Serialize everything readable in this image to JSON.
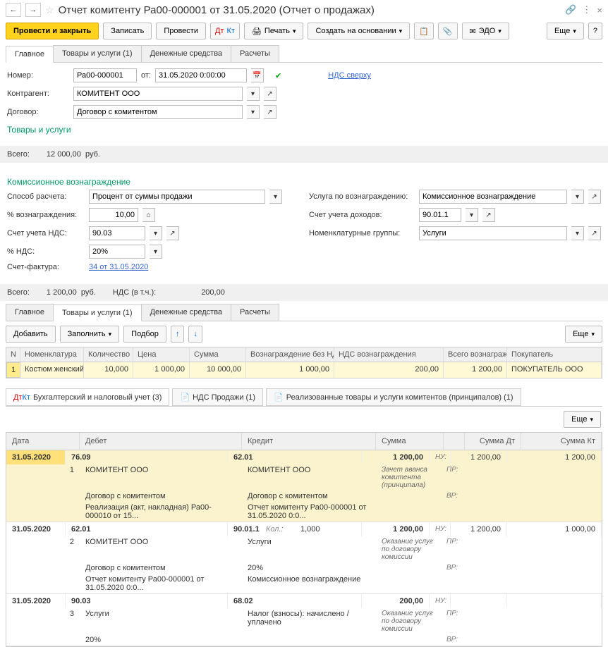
{
  "header": {
    "title": "Отчет комитенту Ра00-000001 от 31.05.2020 (Отчет о продажах)"
  },
  "toolbar": {
    "post_close": "Провести и закрыть",
    "write": "Записать",
    "post": "Провести",
    "print": "Печать",
    "create_based": "Создать на основании",
    "edo": "ЭДО",
    "more": "Еще"
  },
  "tabs": {
    "main": "Главное",
    "goods": "Товары и услуги (1)",
    "cash": "Денежные средства",
    "calc": "Расчеты"
  },
  "form": {
    "number_label": "Номер:",
    "number": "Ра00-000001",
    "from_label": "от:",
    "date": "31.05.2020 0:00:00",
    "vat_link": "НДС сверху",
    "counterparty_label": "Контрагент:",
    "counterparty": "КОМИТЕНТ ООО",
    "contract_label": "Договор:",
    "contract": "Договор с комитентом"
  },
  "goods_section": {
    "heading": "Товары и услуги",
    "total_label": "Всего:",
    "total": "12 000,00",
    "currency": "руб."
  },
  "commission": {
    "heading": "Комиссионное вознаграждение",
    "method_label": "Способ расчета:",
    "method": "Процент от суммы продажи",
    "service_label": "Услуга по вознаграждению:",
    "service": "Комиссионное вознаграждение",
    "percent_label": "% вознаграждения:",
    "percent": "10,00",
    "income_acc_label": "Счет учета доходов:",
    "income_acc": "90.01.1",
    "vat_acc_label": "Счет учета НДС:",
    "vat_acc": "90.03",
    "nom_group_label": "Номенклатурные группы:",
    "nom_group": "Услуги",
    "vat_rate_label": "% НДС:",
    "vat_rate": "20%",
    "invoice_label": "Счет-фактура:",
    "invoice_link": "34 от 31.05.2020",
    "totals": {
      "total_label": "Всего:",
      "total": "1 200,00",
      "currency": "руб.",
      "vat_label": "НДС (в т.ч.):",
      "vat": "200,00"
    }
  },
  "grid_toolbar": {
    "add": "Добавить",
    "fill": "Заполнить",
    "pick": "Подбор",
    "more": "Еще"
  },
  "grid": {
    "headers": {
      "n": "N",
      "nom": "Номенклатура",
      "qty": "Количество",
      "price": "Цена",
      "sum": "Сумма",
      "reward_novat": "Вознаграждение без НДС",
      "reward_vat": "НДС вознаграждения",
      "reward_total": "Всего вознаграждение",
      "buyer": "Покупатель"
    },
    "row": {
      "n": "1",
      "nom": "Костюм женский",
      "qty": "10,000",
      "price": "1 000,00",
      "sum": "10 000,00",
      "reward_novat": "1 000,00",
      "reward_vat": "200,00",
      "reward_total": "1 200,00",
      "buyer": "ПОКУПАТЕЛЬ ООО"
    }
  },
  "acc_tabs": {
    "accounting": "Бухгалтерский и налоговый учет (3)",
    "vat_sales": "НДС Продажи (1)",
    "realized": "Реализованные товары и услуги комитентов (принципалов) (1)",
    "more": "Еще"
  },
  "ledger": {
    "headers": {
      "date": "Дата",
      "debit": "Дебет",
      "credit": "Кредит",
      "sum": "Сумма",
      "sum_dt": "Сумма Дт",
      "sum_kt": "Сумма Кт"
    },
    "tags": {
      "nu": "НУ:",
      "pr": "ПР:",
      "vr": "ВР:",
      "kol": "Кол.:"
    },
    "entries": [
      {
        "date": "31.05.2020",
        "n": "1",
        "d_acc": "76.09",
        "c_acc": "62.01",
        "sum": "1 200,00",
        "dt": "1 200,00",
        "kt": "1 200,00",
        "d1": "КОМИТЕНТ ООО",
        "c1": "КОМИТЕНТ ООО",
        "d2": "Договор с комитентом",
        "c2": "Договор с комитентом",
        "d3": "Реализация (акт, накладная) Ра00-000010 от 15...",
        "c3": "Отчет комитенту Ра00-000001 от 31.05.2020 0:0...",
        "desc": "Зачет аванса комитента (принципала)"
      },
      {
        "date": "31.05.2020",
        "n": "2",
        "d_acc": "62.01",
        "c_acc": "90.01.1",
        "kol": "1,000",
        "sum": "1 200,00",
        "dt": "1 200,00",
        "kt": "1 000,00",
        "d1": "КОМИТЕНТ ООО",
        "c1": "Услуги",
        "d2": "Договор с комитентом",
        "c2": "20%",
        "d3": "Отчет комитенту Ра00-000001 от 31.05.2020 0:0...",
        "c3": "Комиссионное вознаграждение",
        "desc": "Оказание услуг по договору комиссии"
      },
      {
        "date": "31.05.2020",
        "n": "3",
        "d_acc": "90.03",
        "c_acc": "68.02",
        "sum": "200,00",
        "dt": "",
        "kt": "",
        "d1": "Услуги",
        "c1": "Налог (взносы): начислено / уплачено",
        "d2": "20%",
        "c2": "",
        "desc": "Оказание услуг по договору комиссии"
      }
    ]
  }
}
